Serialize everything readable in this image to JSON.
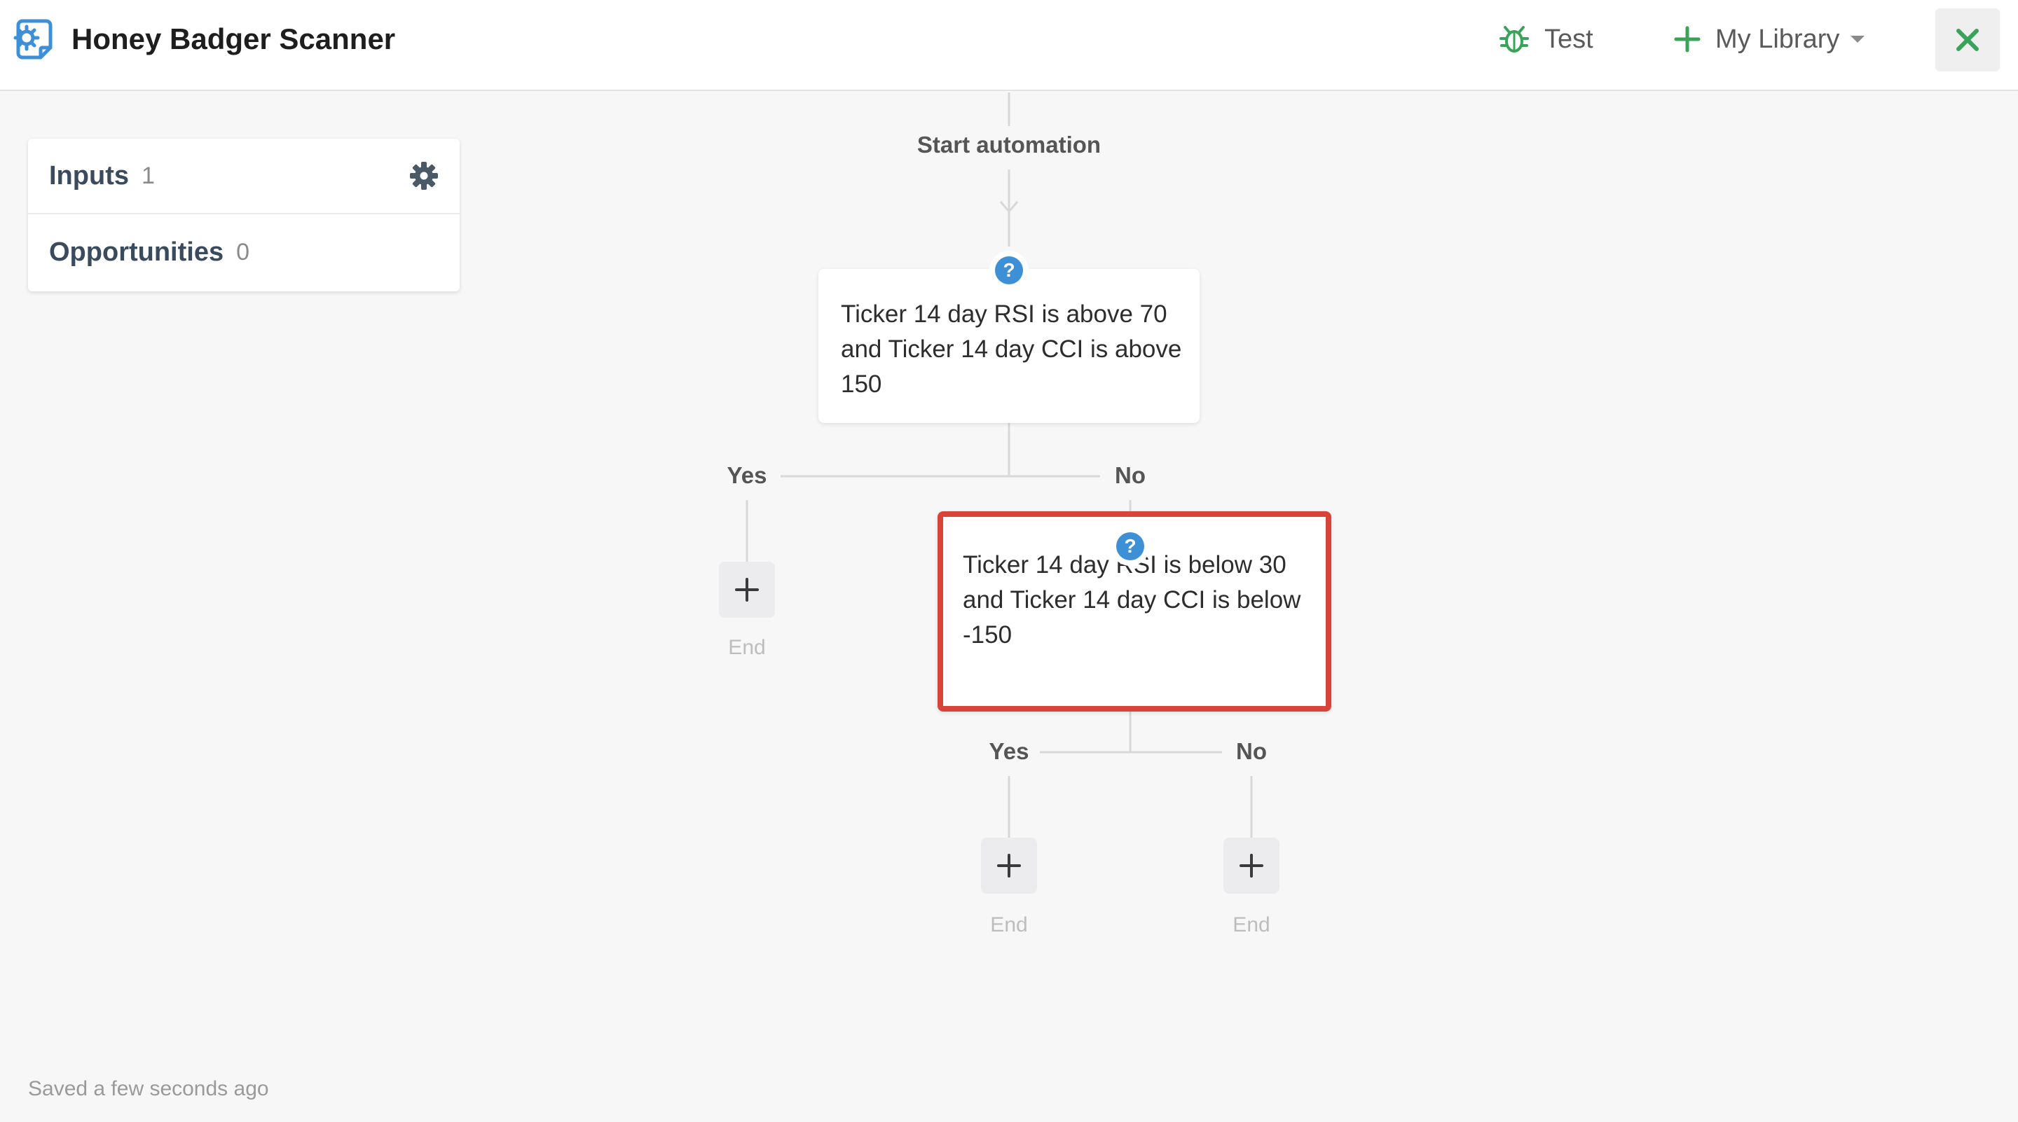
{
  "header": {
    "app_title": "Honey Badger Scanner",
    "app_icon": "document-gear-icon",
    "test_label": "Test",
    "test_icon": "bug-icon",
    "library_label": "My Library",
    "close_icon": "close-icon",
    "accent_color": "#3aa35a"
  },
  "sidebar": {
    "items": [
      {
        "label": "Inputs",
        "count": "1"
      },
      {
        "label": "Opportunities",
        "count": "0"
      }
    ],
    "settings_icon": "gear-icon"
  },
  "flow": {
    "start_label": "Start automation",
    "condition_1": {
      "text": "Ticker 14 day RSI is above 70 and Ticker 14 day CCI is above 150",
      "yes_label": "Yes",
      "no_label": "No"
    },
    "condition_2": {
      "text": "Ticker 14 day RSI is below 30 and Ticker 14 day CCI is below -150",
      "yes_label": "Yes",
      "no_label": "No",
      "highlight_color": "#d9443a"
    },
    "end_label": "End"
  },
  "footer": {
    "status": "Saved a few seconds ago"
  }
}
